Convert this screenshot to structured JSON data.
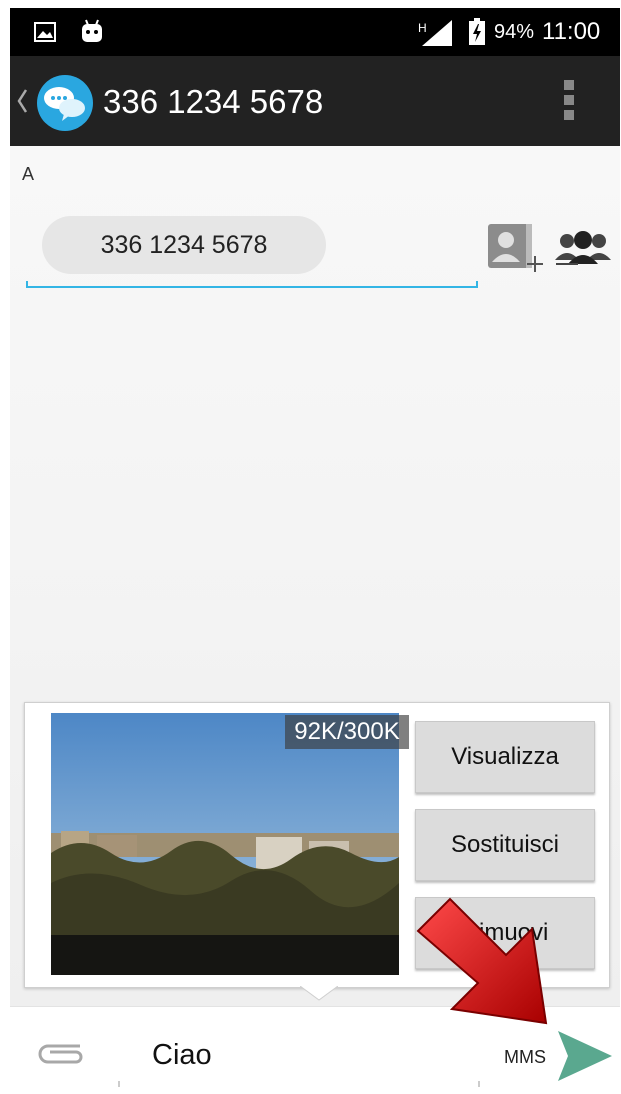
{
  "status_bar": {
    "network_label": "H",
    "battery_percent": "94%",
    "time": "11:00"
  },
  "header": {
    "title": "336 1234 5678",
    "icons": [
      "back-chevron-icon",
      "messaging-app-icon",
      "overflow-menu-icon"
    ]
  },
  "recipient": {
    "label": "A",
    "chip_text": "336 1234 5678",
    "icons": [
      "add-contact-icon",
      "group-contacts-icon"
    ]
  },
  "attachment": {
    "size_text": "92K/300K",
    "buttons": [
      "Visualizza",
      "Sostituisci",
      "Rimuovi"
    ]
  },
  "composer": {
    "message_text": "Ciao",
    "mode_label": "MMS",
    "icons": [
      "paperclip-icon",
      "send-icon"
    ]
  },
  "colors": {
    "action_bar": "#222222",
    "accent": "#33b5e5",
    "send": "#5aa88f",
    "arrow_annotation": "#d90f0f"
  }
}
